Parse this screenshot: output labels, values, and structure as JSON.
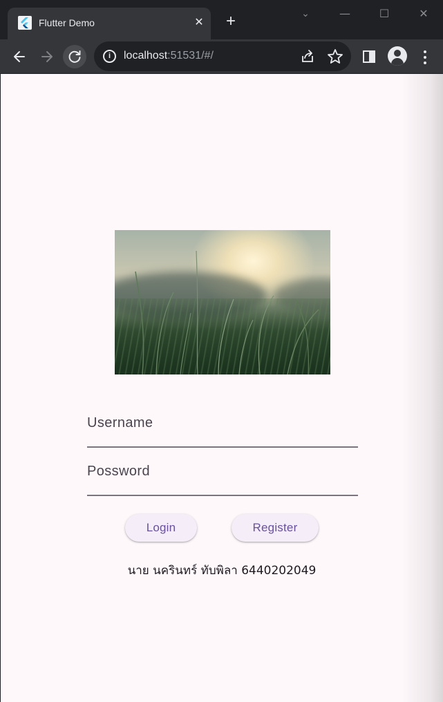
{
  "browser": {
    "tab_title": "Flutter Demo",
    "tab_close": "✕",
    "new_tab": "+",
    "url_host": "localhost",
    "url_rest": ":51531/#/",
    "window_controls": {
      "dropdown": "⌄",
      "minimize": "—",
      "maximize": "☐",
      "close": "✕"
    }
  },
  "icons": {
    "back": "arrow-left-icon",
    "forward": "arrow-right-icon",
    "reload": "reload-icon",
    "info": "info-icon",
    "share": "share-icon",
    "bookmark": "star-icon",
    "side_panel": "side-panel-icon",
    "profile": "profile-icon",
    "menu": "more-vertical-icon"
  },
  "form": {
    "username_label": "Username",
    "password_label": "Possword"
  },
  "buttons": {
    "login": "Login",
    "register": "Register"
  },
  "footer": {
    "text": "นาย นครินทร์ ทับพิลา 6440202049"
  },
  "colors": {
    "page_bg": "#fef8fb",
    "button_text": "#6750a4",
    "button_bg": "#f5eef8",
    "underline": "#79747e"
  }
}
